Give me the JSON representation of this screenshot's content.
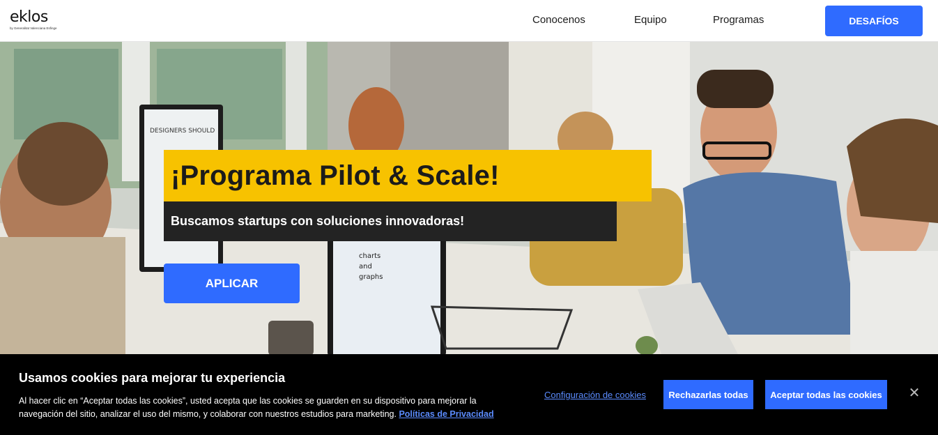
{
  "header": {
    "logo_text": "eklos",
    "logo_subtext": "by Generalitat Valenciana Esfinge",
    "nav": [
      "Conocenos",
      "Equipo",
      "Programas"
    ],
    "cta_label": "DESAFÍOS"
  },
  "hero": {
    "title": "¡Programa Pilot & Scale!",
    "subtitle": "Buscamos startups con soluciones innovadoras!",
    "cta_label": "APLICAR",
    "screen_text_1": "DESIGNERS SHOULD ALWAYS KEEP THEIR USERS IN MIND",
    "screen_text_2": "charts and graphs"
  },
  "cookie_banner": {
    "title": "Usamos cookies para mejorar tu experiencia",
    "text": "Al hacer clic en “Aceptar todas las cookies”, usted acepta que las cookies se guarden en su dispositivo para mejorar la navegación del sitio, analizar el uso del mismo, y colaborar con nuestros estudios para marketing.",
    "privacy_link": "Políticas de Privacidad",
    "config_link": "Configuración de cookies",
    "reject_label": "Rechazarlas todas",
    "accept_label": "Aceptar todas las cookies",
    "close_icon": "close-icon"
  },
  "colors": {
    "primary": "#2f6bff",
    "accent_yellow": "#f7c200",
    "dark": "#232323"
  }
}
